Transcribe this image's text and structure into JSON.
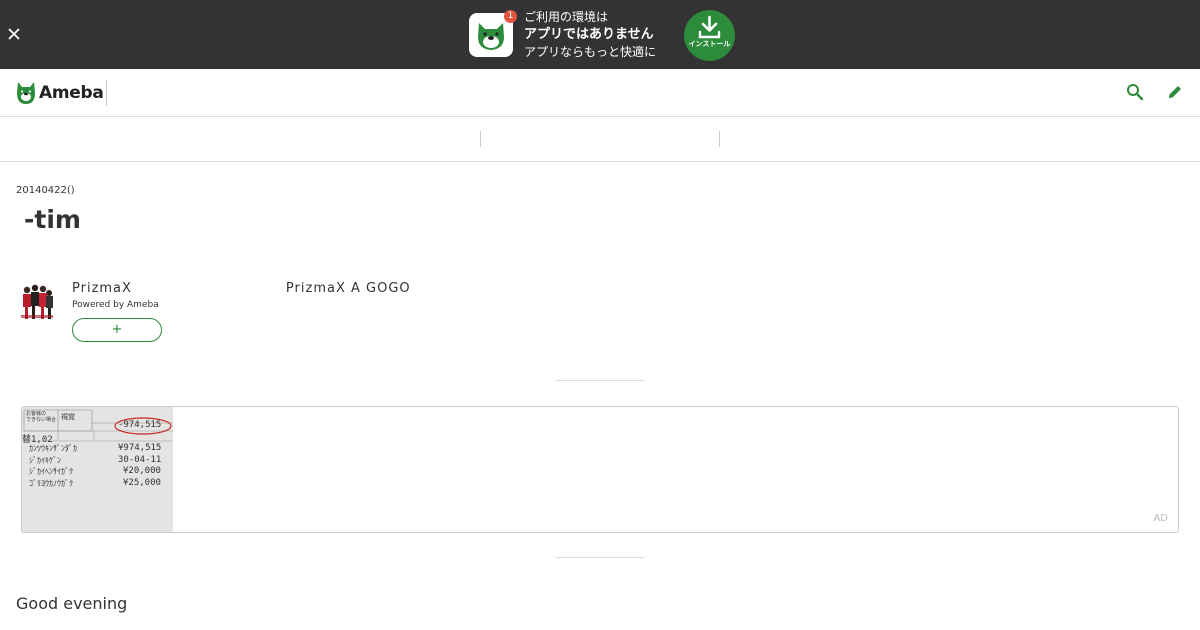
{
  "app_banner": {
    "close_icon": "close-icon",
    "badge_count": "1",
    "line1": "ご利用の環境は",
    "line2": "アプリではありません",
    "line3": "アプリならもっと快適に",
    "install_label": "インストール",
    "install_icon": "download-icon"
  },
  "header": {
    "logo_text": "Ameba",
    "search_icon": "search-icon",
    "edit_icon": "pencil-icon"
  },
  "article": {
    "date": "20140422()",
    "title": " -tim",
    "blog_name": "PrizmaX　　　　　　　　　　　PrizmaX A GOGO　",
    "powered_by": "Powered by Ameba",
    "follow_label": "+",
    "greeting": "Good evening"
  },
  "ad": {
    "label": "AD",
    "receipt": {
      "header_left": "お客様の\nできない場合",
      "header_mid": "視覚",
      "amount_circled": "-974,515",
      "row_prefix": "替1,02",
      "rows": [
        {
          "label": "ｶﾝﾂｳｷﾝｻﾞﾝﾀﾞｶ",
          "value": "¥974,515"
        },
        {
          "label": "ｼﾞｶｲｷｹﾞﾝ",
          "value": "30-04-11"
        },
        {
          "label": "ｼﾞｶｲﾍﾝｻｲｶﾞｸ",
          "value": "¥20,000"
        },
        {
          "label": "ｺﾞﾘﾖｳｶﾉｳｶﾞｸ",
          "value": "¥25,000"
        }
      ]
    }
  },
  "colors": {
    "banner_bg": "#333333",
    "brand_green": "#2d8c3c",
    "badge_red": "#e5533d"
  }
}
